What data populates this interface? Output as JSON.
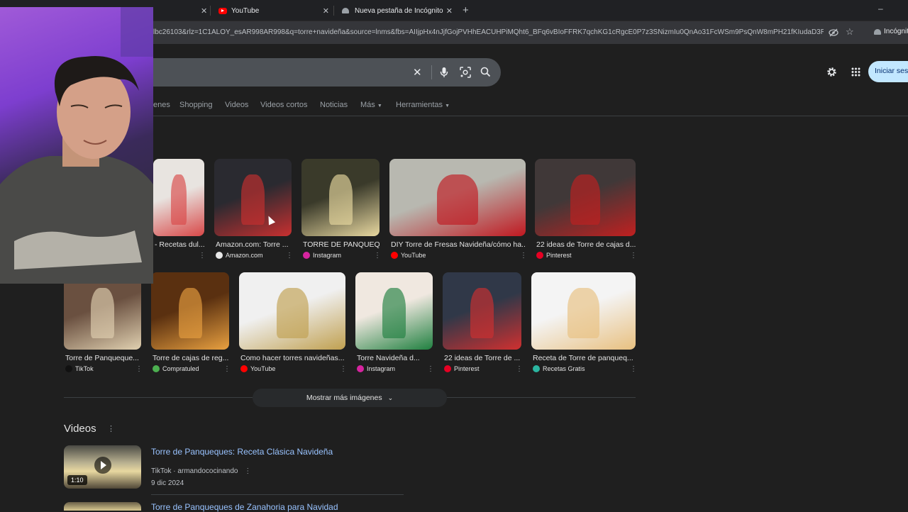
{
  "tabs": [
    {
      "label": "YouTube"
    },
    {
      "label": "Nueva pestaña de Incógnito"
    }
  ],
  "address": {
    "url": "lbc26103&rlz=1C1ALOY_esAR998AR998&q=torre+navideña&source=lnms&fbs=AIIjpHx4nJjfGojPVHhEACUHPiMQht6_BFq6vBIoFFRK7qchKG1cRgcE0P7z3SNizmIu0QnAo31FcWSm9PsQnW8mPH21fKIudaD3R...",
    "incognito_label": "Incógnit"
  },
  "header": {
    "signin_label": "Iniciar sesi"
  },
  "nav": {
    "items": [
      "enes",
      "Shopping",
      "Videos",
      "Videos cortos",
      "Noticias",
      "Más",
      "Herramientas"
    ]
  },
  "images": {
    "row1": [
      {
        "title": "- Recetas dul...",
        "source": "",
        "colors": [
          "#e8e4e0",
          "#d84848"
        ]
      },
      {
        "title": "Amazon.com: Torre ...",
        "source": "Amazon.com",
        "colors": [
          "#2a2a30",
          "#c83030"
        ]
      },
      {
        "title": "TORRE DE PANQUEQ...",
        "source": "Instagram",
        "colors": [
          "#3a3a2a",
          "#e8d8a0"
        ]
      },
      {
        "title": "DIY Torre de Fresas Navideña/cómo ha...",
        "source": "YouTube",
        "colors": [
          "#b8b8b0",
          "#c01820"
        ]
      },
      {
        "title": "22 ideas de Torre de cajas d...",
        "source": "Pinterest",
        "colors": [
          "#403838",
          "#c02020"
        ]
      }
    ],
    "row2": [
      {
        "title": "Torre de Panqueque...",
        "source": "TikTok",
        "colors": [
          "#6a5040",
          "#e0d0b0"
        ]
      },
      {
        "title": "Torre de cajas de reg...",
        "source": "Compratuled",
        "colors": [
          "#5a3010",
          "#e8a040"
        ]
      },
      {
        "title": "Como hacer torres navideñas...",
        "source": "YouTube",
        "colors": [
          "#f0f0f0",
          "#c0a050"
        ]
      },
      {
        "title": "Torre Navideña d...",
        "source": "Instagram",
        "colors": [
          "#f0e8e0",
          "#208040"
        ]
      },
      {
        "title": "22 ideas de Torre de ...",
        "source": "Pinterest",
        "colors": [
          "#303848",
          "#d03030"
        ]
      },
      {
        "title": "Receta de Torre de panqueq...",
        "source": "Recetas Gratis",
        "colors": [
          "#f4f4f4",
          "#e8c080"
        ]
      }
    ]
  },
  "more_images_label": "Mostrar más imágenes",
  "videos": {
    "heading": "Videos",
    "items": [
      {
        "title": "Torre de Panqueques: Receta Clásica Navideña",
        "platform": "TikTok",
        "author": "armandococinando",
        "date": "9 dic 2024",
        "duration": "1:10"
      },
      {
        "title": "Torre de Panqueques de Zanahoria para Navidad"
      }
    ]
  },
  "colors": {
    "link": "#99c3ff",
    "signin_bg": "#c2e7ff",
    "background": "#1f1f1f"
  }
}
